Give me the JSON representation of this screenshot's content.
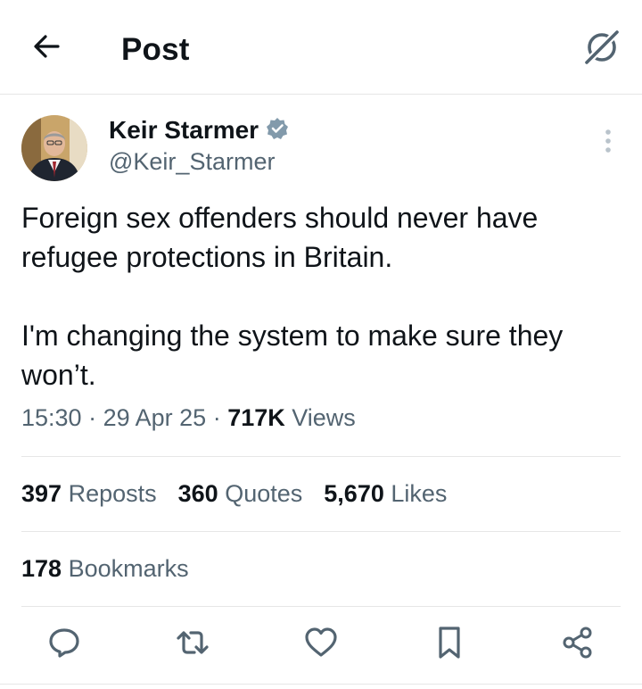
{
  "header": {
    "title": "Post",
    "back_icon": "arrow-left-icon",
    "grok_icon": "grok-icon"
  },
  "author": {
    "display_name": "Keir Starmer",
    "handle": "@Keir_Starmer",
    "verified_badge": "verified-badge-icon",
    "badge_color": "#829aab"
  },
  "post": {
    "paragraph_1": "Foreign sex offenders should never have refugee protections in Britain.",
    "paragraph_2": "I'm changing the system to make sure they won’t.",
    "time": "15:30",
    "date": "29 Apr 25",
    "views_count": "717K",
    "views_label": "Views"
  },
  "stats": {
    "reposts_count": "397",
    "reposts_label": "Reposts",
    "quotes_count": "360",
    "quotes_label": "Quotes",
    "likes_count": "5,670",
    "likes_label": "Likes",
    "bookmarks_count": "178",
    "bookmarks_label": "Bookmarks"
  },
  "actions": [
    "reply-icon",
    "repost-icon",
    "like-icon",
    "bookmark-icon",
    "share-icon"
  ],
  "colors": {
    "text_primary": "#0f1419",
    "text_secondary": "#536471",
    "divider": "#e6e6e6"
  }
}
